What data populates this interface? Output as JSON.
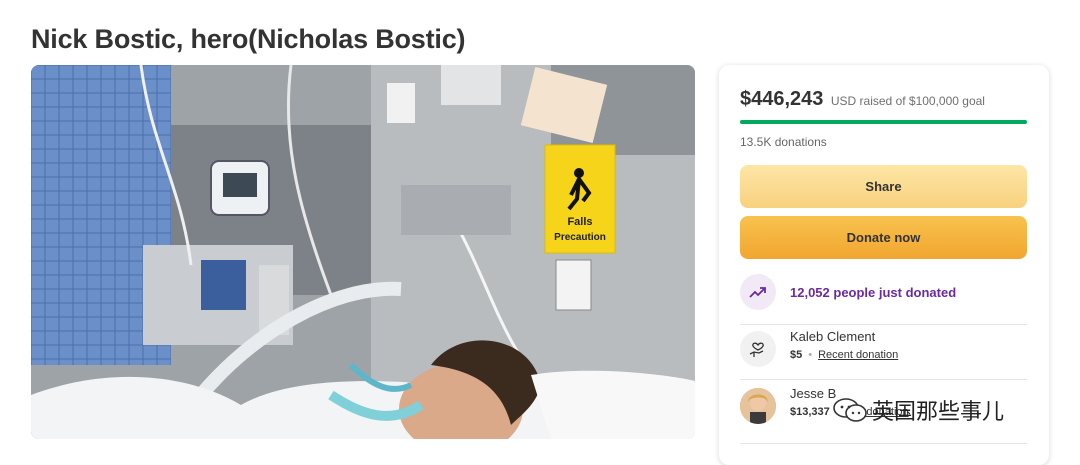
{
  "page": {
    "title": "Nick Bostic, hero(Nicholas Bostic)"
  },
  "campaign": {
    "image_alt": "Photo of a man in a hospital bed with medical equipment and a Falls Precaution sign",
    "sign_text_line1": "Falls",
    "sign_text_line2": "Precaution"
  },
  "donate_card": {
    "raised_amount": "$446,243",
    "raised_sub": "USD raised of $100,000 goal",
    "progress_fraction": 1.0,
    "donation_count": "13.5K donations",
    "share_label": "Share",
    "donate_label": "Donate now",
    "trend_text": "12,052 people just donated",
    "donors": [
      {
        "name": "Kaleb Clement",
        "amount": "$5",
        "label": "Recent donation"
      },
      {
        "name": "Jesse B",
        "amount": "$13,337",
        "label": "Top donation"
      }
    ]
  },
  "watermark": {
    "text": "英国那些事儿"
  },
  "colors": {
    "progress": "#02a95c",
    "share_button": "#fbdc93",
    "donate_button": "#f4b13e",
    "trend_text": "#6b2aa0",
    "sign_yellow": "#f5d41a"
  },
  "icons": {
    "trend": "trending-up-icon",
    "donor_placeholder": "hand-heart-icon",
    "watermark": "chat-bubbles-icon"
  }
}
